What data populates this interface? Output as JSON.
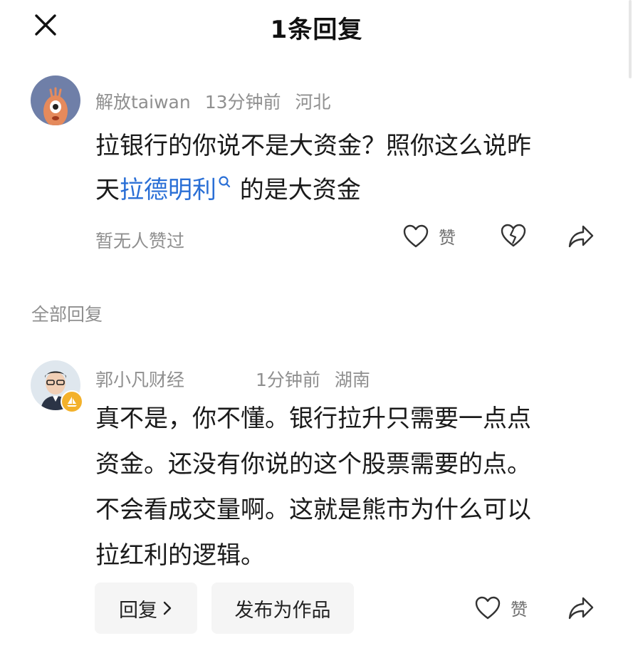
{
  "header": {
    "title": "1条回复"
  },
  "comment": {
    "username": "解放taiwan",
    "time": "13分钟前",
    "location": "河北",
    "text_part1": "拉银行的你说不是大资金？照你这么说昨",
    "text_part2_prefix": "天",
    "link_text": "拉德明利",
    "text_part2_suffix": " 的是大资金",
    "like_status": "暂无人赞过",
    "like_label": "赞"
  },
  "section_label": "全部回复",
  "reply": {
    "username": "郭小凡财经",
    "time": "1分钟前",
    "location": "湖南",
    "lines": [
      "真不是，你不懂。银行拉升只需要一点点",
      "资金。还没有你说的这个股票需要的点。",
      "不会看成交量啊。这就是熊市为什么可以",
      "拉红利的逻辑。"
    ],
    "reply_button": "回复",
    "publish_button": "发布为作品",
    "like_label": "赞"
  },
  "colors": {
    "link": "#2a6fd6",
    "muted": "#8f8f8f",
    "pill_bg": "#f5f5f5",
    "badge": "#f3b12b"
  },
  "icons": [
    "close-icon",
    "link-search-icon",
    "heart-icon",
    "broken-heart-icon",
    "share-arrow-icon",
    "chevron-right-icon",
    "sailboat-badge-icon"
  ]
}
